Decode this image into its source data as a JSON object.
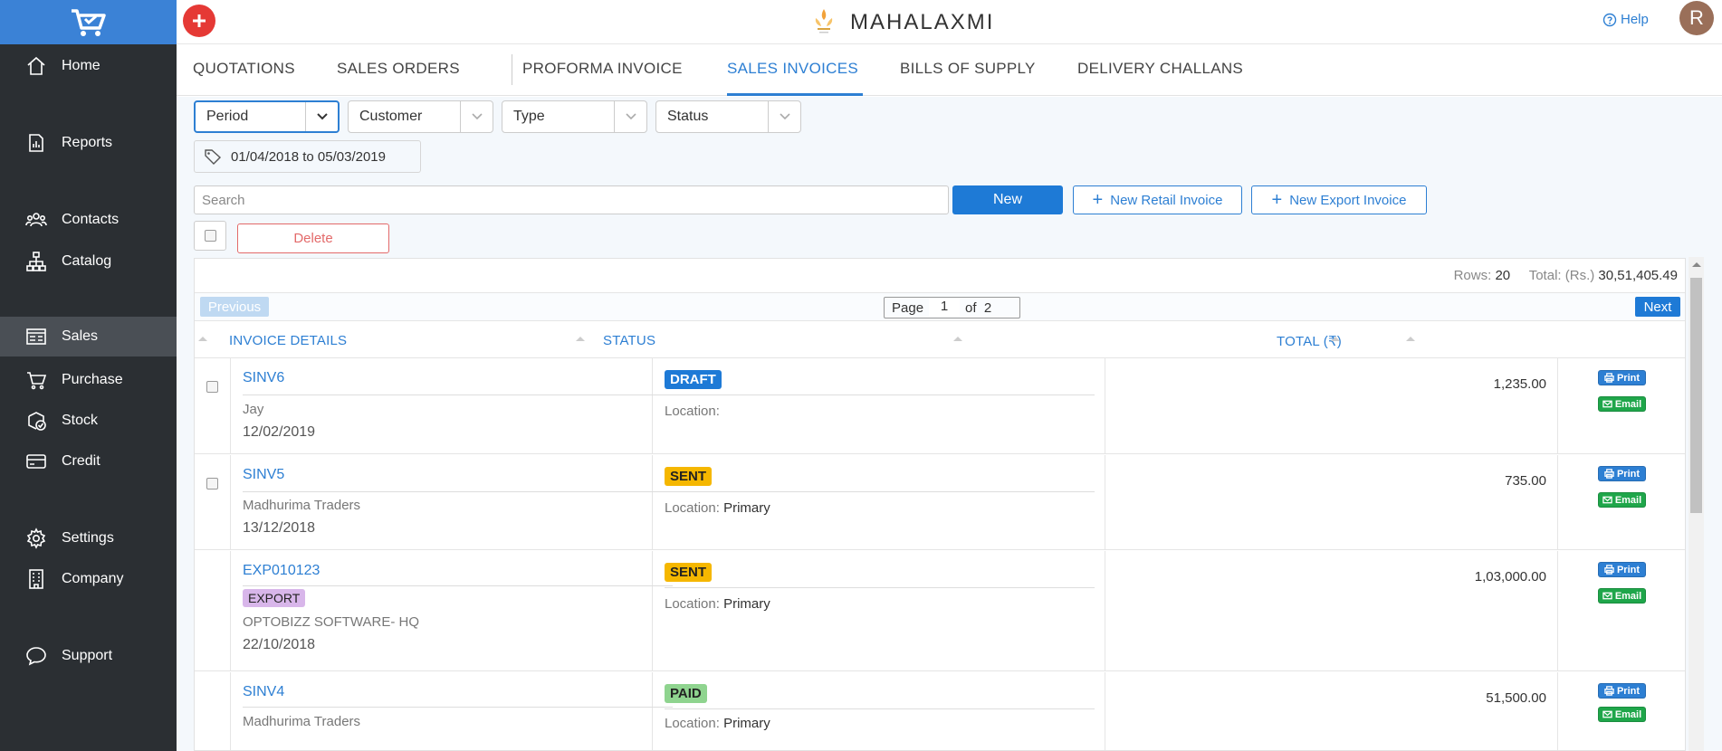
{
  "app": {
    "brand_name": "MAHALAXMI",
    "help_label": "Help",
    "user_initial": "R"
  },
  "sidebar": {
    "items": [
      {
        "label": "Home",
        "icon": "home-icon"
      },
      {
        "label": "Reports",
        "icon": "reports-icon"
      },
      {
        "label": "Contacts",
        "icon": "contacts-icon"
      },
      {
        "label": "Catalog",
        "icon": "catalog-icon"
      },
      {
        "label": "Sales",
        "icon": "sales-icon",
        "active": true
      },
      {
        "label": "Purchase",
        "icon": "cart-icon"
      },
      {
        "label": "Stock",
        "icon": "stock-icon"
      },
      {
        "label": "Credit",
        "icon": "credit-card-icon"
      },
      {
        "label": "Settings",
        "icon": "gear-icon"
      },
      {
        "label": "Company",
        "icon": "building-icon"
      },
      {
        "label": "Support",
        "icon": "chat-icon"
      }
    ]
  },
  "tabs": [
    {
      "label": "QUOTATIONS"
    },
    {
      "label": "SALES ORDERS"
    },
    {
      "label": "PROFORMA INVOICE"
    },
    {
      "label": "SALES INVOICES",
      "active": true
    },
    {
      "label": "BILLS OF SUPPLY"
    },
    {
      "label": "DELIVERY CHALLANS"
    }
  ],
  "filters": {
    "period": "Period",
    "customer": "Customer",
    "type": "Type",
    "status": "Status",
    "period_range": "01/04/2018 to 05/03/2019"
  },
  "toolbar": {
    "search_placeholder": "Search",
    "new_label": "New",
    "new_retail_label": "New Retail Invoice",
    "new_export_label": "New Export Invoice",
    "delete_label": "Delete"
  },
  "summary": {
    "rows_label": "Rows:",
    "rows_value": "20",
    "total_label": "Total: (Rs.)",
    "total_value": "30,51,405.49"
  },
  "pager": {
    "previous_label": "Previous",
    "page_label": "Page",
    "page_current": "1",
    "of_label": "of",
    "page_total": "2",
    "next_label": "Next"
  },
  "table": {
    "columns": [
      "INVOICE DETAILS",
      "STATUS",
      "TOTAL (₹)"
    ],
    "location_label": "Location:",
    "print_label": "Print",
    "email_label": "Email",
    "rows": [
      {
        "invoice": "SINV6",
        "customer": "Jay",
        "date": "12/02/2019",
        "status": "DRAFT",
        "location": "",
        "total": "1,235.00"
      },
      {
        "invoice": "SINV5",
        "customer": "Madhurima Traders",
        "date": "13/12/2018",
        "status": "SENT",
        "location": "Primary",
        "total": "735.00"
      },
      {
        "invoice": "EXP010123",
        "badge": "EXPORT",
        "customer": "OPTOBIZZ SOFTWARE- HQ",
        "date": "22/10/2018",
        "status": "SENT",
        "location": "Primary",
        "total": "1,03,000.00"
      },
      {
        "invoice": "SINV4",
        "customer": "Madhurima Traders",
        "date": "",
        "status": "PAID",
        "location": "Primary",
        "total": "51,500.00"
      }
    ]
  },
  "colors": {
    "accent": "#2d7fd3",
    "sidebar_bg": "#2b2f33",
    "logo_bg": "#3b82d6",
    "draft": "#1e7ad6",
    "sent": "#f5b700",
    "paid": "#8fd48f",
    "export": "#d8b6ea"
  }
}
